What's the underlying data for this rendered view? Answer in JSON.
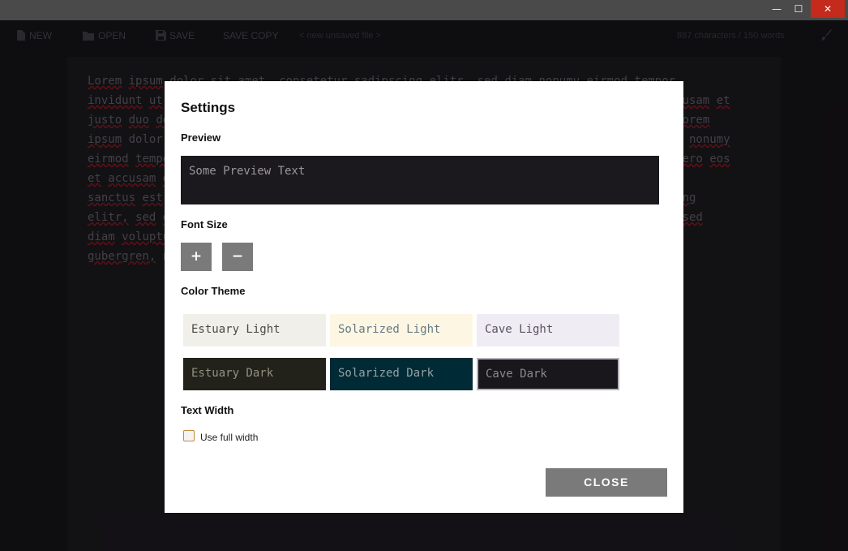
{
  "window": {
    "minimize_glyph": "—",
    "maximize_glyph": "☐",
    "close_glyph": "✕"
  },
  "toolbar": {
    "new_label": "NEW",
    "new_icon": "file-icon",
    "open_label": "OPEN",
    "open_icon": "folder-icon",
    "save_label": "SAVE",
    "save_icon": "floppy-icon",
    "save_copy_label": "SAVE COPY",
    "file_name": "< new unsaved file >",
    "stats": "887 characters / 150 words",
    "theme_icon": "brush-icon"
  },
  "editor": {
    "lines": [
      "Lorem ipsum dolor sit amet, consetetur sadipscing elitr, sed diam nonumy eirmod tempor",
      "invidunt ut labore et dolore magna aliquyam erat, sed diam voluptua. At vero eos et accusam et",
      "justo duo dolores et ea rebum. Stet clita kasd gubergren, no sea takimata sanctus est Lorem",
      "ipsum dolor sit amet. Lorem ipsum dolor sit amet, consetetur sadipscing elitr, sed diam nonumy",
      "eirmod tempor invidunt ut labore et dolore magna aliquyam erat, sed diam voluptua. At vero eos",
      "et accusam et justo duo dolores et ea rebum. Stet clita kasd gubergren, no sea takimata",
      "sanctus est Lorem ipsum dolor sit amet. Lorem ipsum dolor sit amet, consetetur sadipscing",
      "elitr, sed diam nonumy eirmod tempor invidunt ut labore et dolore magna aliquyam erat, sed",
      "diam voluptua. At vero eos et accusam et justo duo dolores et ea rebum. Stet clita kasd",
      "gubergren, no sea takimata sanctus est Lorem ipsum dolor sit amet."
    ]
  },
  "settings": {
    "title": "Settings",
    "preview_label": "Preview",
    "preview_text": "Some Preview Text",
    "font_size_label": "Font Size",
    "increase_label": "+",
    "decrease_label": "−",
    "color_theme_label": "Color Theme",
    "themes": [
      {
        "name": "Estuary Light",
        "bg": "#f0efea",
        "fg": "#4a4a44",
        "selected": false
      },
      {
        "name": "Solarized Light",
        "bg": "#fdf6e3",
        "fg": "#657b83",
        "selected": false
      },
      {
        "name": "Cave Light",
        "bg": "#efecf4",
        "fg": "#585260",
        "selected": false
      },
      {
        "name": "Estuary Dark",
        "bg": "#22221b",
        "fg": "#929181",
        "selected": false
      },
      {
        "name": "Solarized Dark",
        "bg": "#002b36",
        "fg": "#93a1a1",
        "selected": false
      },
      {
        "name": "Cave Dark",
        "bg": "#19171c",
        "fg": "#8b8792",
        "selected": true
      }
    ],
    "text_width_label": "Text Width",
    "full_width_label": "Use full width",
    "full_width_checked": false,
    "close_label": "CLOSE"
  },
  "colors": {
    "dialog_button": "#7a7a7a",
    "window_close": "#c42b1c",
    "spellcheck_underline": "#b0202a"
  }
}
